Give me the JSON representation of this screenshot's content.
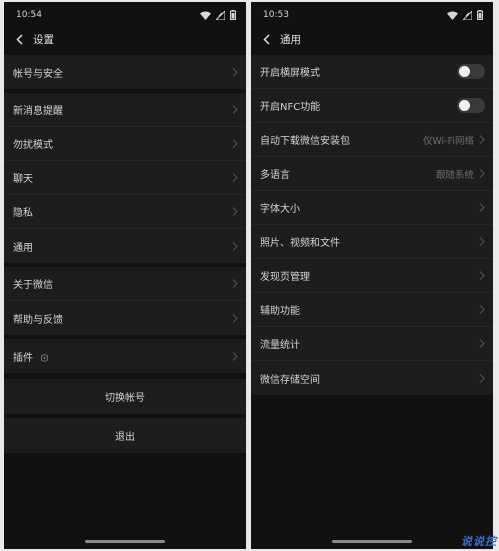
{
  "left": {
    "status": {
      "time": "10:54"
    },
    "nav": {
      "title": "设置"
    },
    "groups": [
      {
        "items": [
          {
            "label": "帐号与安全"
          }
        ]
      },
      {
        "items": [
          {
            "label": "新消息提醒"
          },
          {
            "label": "勿扰模式"
          },
          {
            "label": "聊天"
          },
          {
            "label": "隐私"
          },
          {
            "label": "通用"
          }
        ]
      },
      {
        "items": [
          {
            "label": "关于微信"
          },
          {
            "label": "帮助与反馈"
          }
        ]
      },
      {
        "items": [
          {
            "label": "插件",
            "icon": "plugin-icon"
          }
        ]
      }
    ],
    "actions": {
      "switch_account": "切换帐号",
      "logout": "退出"
    }
  },
  "right": {
    "status": {
      "time": "10:53"
    },
    "nav": {
      "title": "通用"
    },
    "items": [
      {
        "label": "开启横屏模式",
        "toggle": false
      },
      {
        "label": "开启NFC功能",
        "toggle": false
      },
      {
        "label": "自动下载微信安装包",
        "value": "仅Wi-Fi网络"
      },
      {
        "label": "多语言",
        "value": "跟随系统"
      },
      {
        "label": "字体大小"
      },
      {
        "label": "照片、视频和文件"
      },
      {
        "label": "发现页管理"
      },
      {
        "label": "辅助功能"
      },
      {
        "label": "流量统计"
      },
      {
        "label": "微信存储空间"
      }
    ]
  },
  "watermark": "说说控",
  "colors": {
    "background": "#111111",
    "row_bg": "#1d1d1d",
    "text": "#d4d4d4",
    "muted": "#6e6e6e",
    "watermark": "#3b6fd0"
  }
}
